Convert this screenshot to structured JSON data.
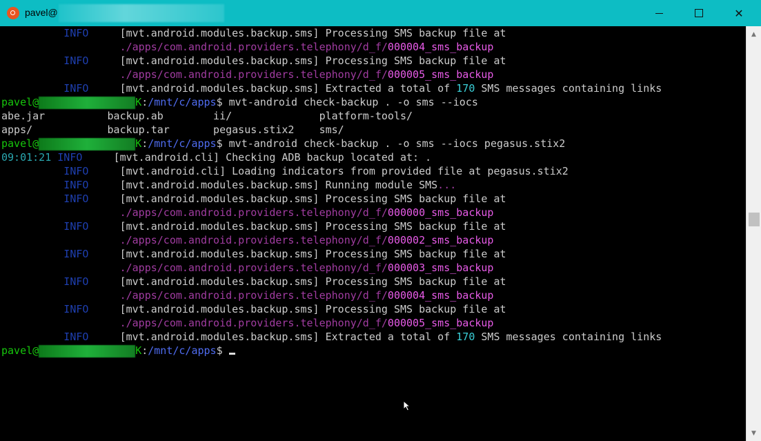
{
  "window": {
    "title_prefix": "pavel@"
  },
  "terminal": {
    "colors": {
      "default": "#cccccc",
      "info": "#1e3fb0",
      "path": "#a13ca1",
      "file": "#e85be8",
      "prompt_user": "#16c60c",
      "prompt_path": "#4f6cf0",
      "number": "#3ad0d8",
      "time": "#2aa8b0"
    },
    "lines": [
      [
        {
          "t": "          INFO     ",
          "c": "info"
        },
        {
          "t": "[mvt.android.modules.backup.sms] Processing SMS backup file at",
          "c": "default"
        }
      ],
      [
        {
          "t": "                   ",
          "c": "default"
        },
        {
          "t": "./apps/com.android.providers.telephony/d_f/",
          "c": "path"
        },
        {
          "t": "000004_sms_backup",
          "c": "file"
        }
      ],
      [
        {
          "t": "          INFO     ",
          "c": "info"
        },
        {
          "t": "[mvt.android.modules.backup.sms] Processing SMS backup file at",
          "c": "default"
        }
      ],
      [
        {
          "t": "                   ",
          "c": "default"
        },
        {
          "t": "./apps/com.android.providers.telephony/d_f/",
          "c": "path"
        },
        {
          "t": "000005_sms_backup",
          "c": "file"
        }
      ],
      [
        {
          "t": "          INFO     ",
          "c": "info"
        },
        {
          "t": "[mvt.android.modules.backup.sms] Extracted a total of ",
          "c": "default"
        },
        {
          "t": "170",
          "c": "number"
        },
        {
          "t": " SMS messages containing links",
          "c": "default"
        }
      ],
      [
        {
          "t": "pavel@",
          "c": "prompt_user"
        },
        {
          "blur": true
        },
        {
          "t": "K",
          "c": "prompt_user"
        },
        {
          "t": ":",
          "c": "default"
        },
        {
          "t": "/mnt/c/apps",
          "c": "prompt_path"
        },
        {
          "t": "$ mvt-android check-backup . -o sms --iocs",
          "c": "default"
        }
      ],
      [
        {
          "t": "abe.jar          backup.ab        ii/              platform-tools/",
          "c": "default"
        }
      ],
      [
        {
          "t": "apps/            backup.tar       pegasus.stix2    sms/",
          "c": "default"
        }
      ],
      [
        {
          "t": "pavel@",
          "c": "prompt_user"
        },
        {
          "blur": true
        },
        {
          "t": "K",
          "c": "prompt_user"
        },
        {
          "t": ":",
          "c": "default"
        },
        {
          "t": "/mnt/c/apps",
          "c": "prompt_path"
        },
        {
          "t": "$ mvt-android check-backup . -o sms --iocs pegasus.stix2",
          "c": "default"
        }
      ],
      [
        {
          "t": "09:01:21 ",
          "c": "time"
        },
        {
          "t": "INFO     ",
          "c": "info"
        },
        {
          "t": "[mvt.android.cli] Checking ADB backup located at: .",
          "c": "default"
        }
      ],
      [
        {
          "t": "          INFO     ",
          "c": "info"
        },
        {
          "t": "[mvt.android.cli] Loading indicators from provided file at pegasus.stix2",
          "c": "default"
        }
      ],
      [
        {
          "t": "          INFO     ",
          "c": "info"
        },
        {
          "t": "[mvt.android.modules.backup.sms] Running module SMS",
          "c": "default"
        },
        {
          "t": "...",
          "c": "path"
        }
      ],
      [
        {
          "t": "          INFO     ",
          "c": "info"
        },
        {
          "t": "[mvt.android.modules.backup.sms] Processing SMS backup file at",
          "c": "default"
        }
      ],
      [
        {
          "t": "                   ",
          "c": "default"
        },
        {
          "t": "./apps/com.android.providers.telephony/d_f/",
          "c": "path"
        },
        {
          "t": "000000_sms_backup",
          "c": "file"
        }
      ],
      [
        {
          "t": "          INFO     ",
          "c": "info"
        },
        {
          "t": "[mvt.android.modules.backup.sms] Processing SMS backup file at",
          "c": "default"
        }
      ],
      [
        {
          "t": "                   ",
          "c": "default"
        },
        {
          "t": "./apps/com.android.providers.telephony/d_f/",
          "c": "path"
        },
        {
          "t": "000002_sms_backup",
          "c": "file"
        }
      ],
      [
        {
          "t": "          INFO     ",
          "c": "info"
        },
        {
          "t": "[mvt.android.modules.backup.sms] Processing SMS backup file at",
          "c": "default"
        }
      ],
      [
        {
          "t": "                   ",
          "c": "default"
        },
        {
          "t": "./apps/com.android.providers.telephony/d_f/",
          "c": "path"
        },
        {
          "t": "000003_sms_backup",
          "c": "file"
        }
      ],
      [
        {
          "t": "          INFO     ",
          "c": "info"
        },
        {
          "t": "[mvt.android.modules.backup.sms] Processing SMS backup file at",
          "c": "default"
        }
      ],
      [
        {
          "t": "                   ",
          "c": "default"
        },
        {
          "t": "./apps/com.android.providers.telephony/d_f/",
          "c": "path"
        },
        {
          "t": "000004_sms_backup",
          "c": "file"
        }
      ],
      [
        {
          "t": "          INFO     ",
          "c": "info"
        },
        {
          "t": "[mvt.android.modules.backup.sms] Processing SMS backup file at",
          "c": "default"
        }
      ],
      [
        {
          "t": "                   ",
          "c": "default"
        },
        {
          "t": "./apps/com.android.providers.telephony/d_f/",
          "c": "path"
        },
        {
          "t": "000005_sms_backup",
          "c": "file"
        }
      ],
      [
        {
          "t": "          INFO     ",
          "c": "info"
        },
        {
          "t": "[mvt.android.modules.backup.sms] Extracted a total of ",
          "c": "default"
        },
        {
          "t": "170",
          "c": "number"
        },
        {
          "t": " SMS messages containing links",
          "c": "default"
        }
      ],
      [
        {
          "t": "pavel@",
          "c": "prompt_user"
        },
        {
          "blur": true
        },
        {
          "t": "K",
          "c": "prompt_user"
        },
        {
          "t": ":",
          "c": "default"
        },
        {
          "t": "/mnt/c/apps",
          "c": "prompt_path"
        },
        {
          "t": "$ ",
          "c": "default"
        },
        {
          "cursor": true
        }
      ]
    ]
  }
}
